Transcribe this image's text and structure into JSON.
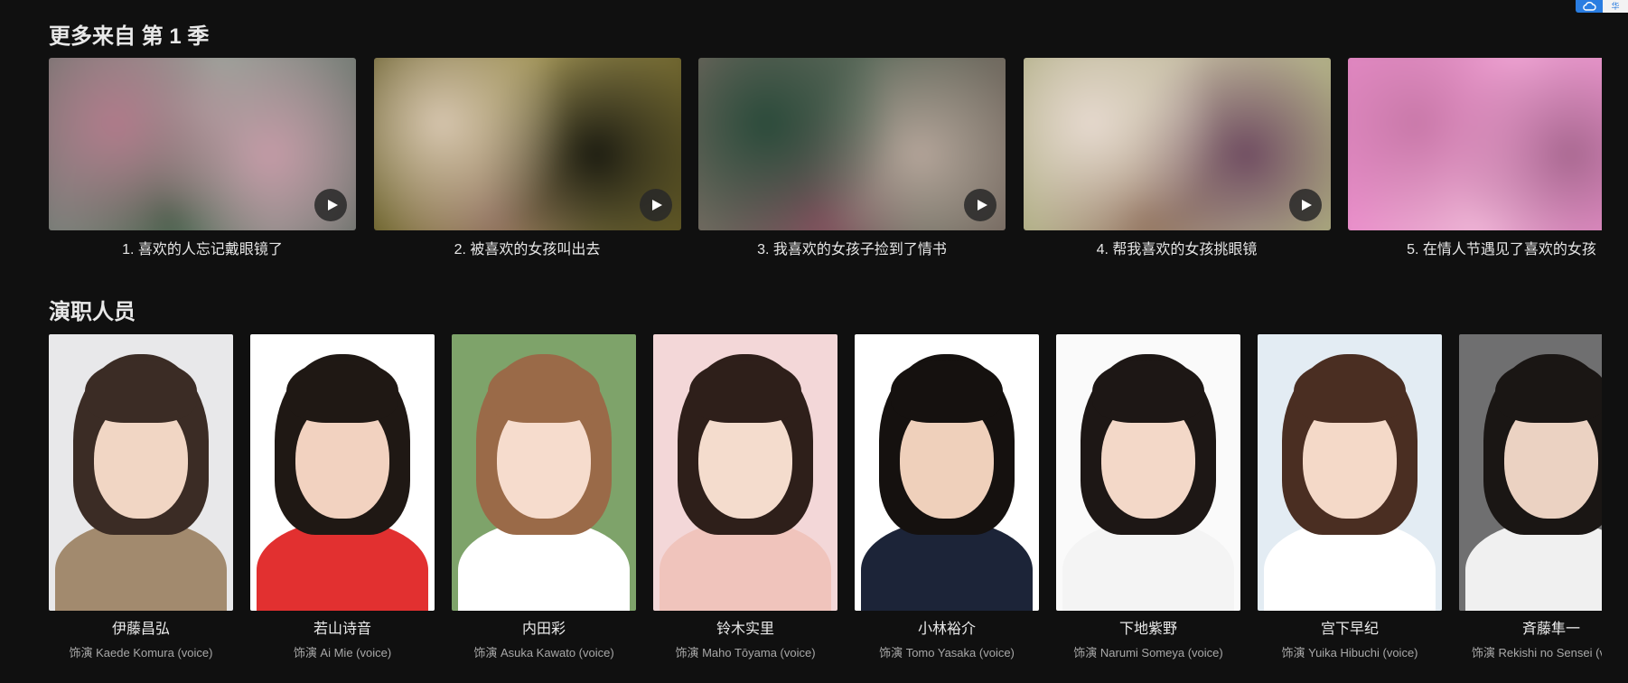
{
  "episodes_section": {
    "title": "更多来自 第 1 季",
    "episodes": [
      {
        "label": "1. 喜欢的人忘记戴眼镜了",
        "colors": [
          "#6b6f6a",
          "#9aa39a",
          "#b07a8a",
          "#3f5b44",
          "#c49aa6"
        ]
      },
      {
        "label": "2. 被喜欢的女孩叫出去",
        "colors": [
          "#59511f",
          "#a89a5a",
          "#d7c6b0",
          "#8a6a5a",
          "#1a1a10"
        ]
      },
      {
        "label": "3. 我喜欢的女孩子捡到了情书",
        "colors": [
          "#7a6a62",
          "#5a6a5a",
          "#2a4a3a",
          "#8a5060",
          "#b5a59a"
        ]
      },
      {
        "label": "4. 帮我喜欢的女孩挑眼镜",
        "colors": [
          "#a8a87a",
          "#c7bfa5",
          "#e6d9cf",
          "#8a6a55",
          "#6e4a60"
        ]
      },
      {
        "label": "5. 在情人节遇见了喜欢的女孩",
        "colors": [
          "#e888c8",
          "#f4a8d8",
          "#c878a8",
          "#f0b8d8",
          "#a86890"
        ]
      }
    ]
  },
  "cast_section": {
    "title": "演职人员",
    "cast": [
      {
        "name": "伊藤昌弘",
        "role": "饰演 Kaede Komura (voice)",
        "bg": "#e8e8ea",
        "hair": "#3b2c25",
        "skin": "#f1d6c4",
        "cloth": "#a28a6e"
      },
      {
        "name": "若山诗音",
        "role": "饰演 Ai Mie (voice)",
        "bg": "#ffffff",
        "hair": "#1f1814",
        "skin": "#f2d2c0",
        "cloth": "#e23030"
      },
      {
        "name": "内田彩",
        "role": "饰演 Asuka Kawato (voice)",
        "bg": "#7ea36a",
        "hair": "#9a6a48",
        "skin": "#f6dccd",
        "cloth": "#ffffff"
      },
      {
        "name": "铃木实里",
        "role": "饰演 Maho Tōyama (voice)",
        "bg": "#f3d7d8",
        "hair": "#2e1f1a",
        "skin": "#f4dccd",
        "cloth": "#f0c4bc"
      },
      {
        "name": "小林裕介",
        "role": "饰演 Tomo Yasaka (voice)",
        "bg": "#ffffff",
        "hair": "#15110f",
        "skin": "#efd0bb",
        "cloth": "#1c2438"
      },
      {
        "name": "下地紫野",
        "role": "饰演 Narumi Someya (voice)",
        "bg": "#fafafa",
        "hair": "#1d1715",
        "skin": "#f3d8c8",
        "cloth": "#f4f4f4"
      },
      {
        "name": "宫下早纪",
        "role": "饰演 Yuika Hibuchi (voice)",
        "bg": "#e3ecf3",
        "hair": "#4a2e22",
        "skin": "#f4d9c8",
        "cloth": "#ffffff"
      },
      {
        "name": "斉藤隼一",
        "role": "饰演 Rekishi no Sensei (voice)",
        "bg": "#6f6f70",
        "hair": "#1a1614",
        "skin": "#ebd2c2",
        "cloth": "#f0f0f0"
      }
    ]
  },
  "cloud_widget": {
    "tab_text": "华"
  }
}
